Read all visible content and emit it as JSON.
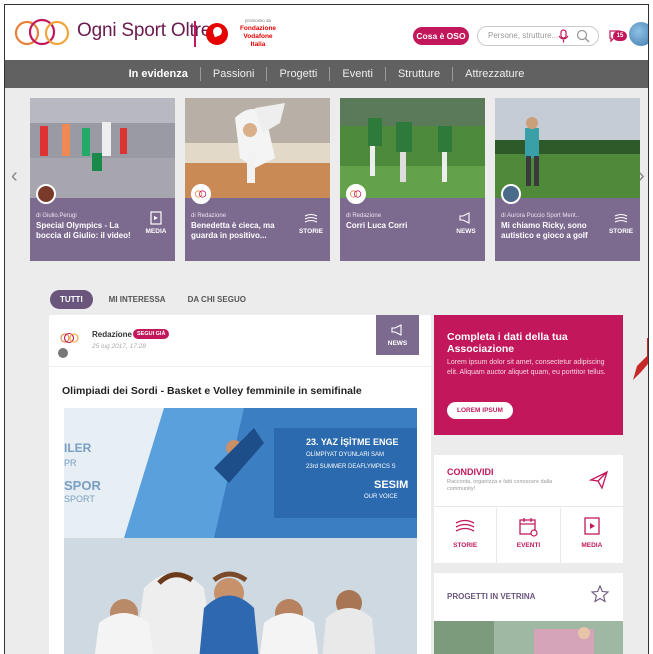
{
  "brand": {
    "name": "Ogni Sport Oltre",
    "partner_small": "promosso da",
    "partner_line1": "Fondazione",
    "partner_line2": "Vodafone",
    "partner_line3": "Italia"
  },
  "header": {
    "cosa_button": "Cosa è OSO",
    "search_placeholder": "Persone, strutture...",
    "notification_count": "15"
  },
  "nav": {
    "items": [
      "In evidenza",
      "Passioni",
      "Progetti",
      "Eventi",
      "Strutture",
      "Attrezzature"
    ],
    "active": "In evidenza"
  },
  "carousel": {
    "cards": [
      {
        "author": "di Giulio.Perugi",
        "title": "Special Olympics - La boccia di Giulio: il video!",
        "category": "MEDIA"
      },
      {
        "author": "di Redazione",
        "title": "Benedetta è cieca, ma guarda in positivo...",
        "category": "STORIE"
      },
      {
        "author": "di Redazione",
        "title": "Corri Luca Corri",
        "category": "NEWS"
      },
      {
        "author": "di Aurora Puccio Sport Ment..",
        "title": "Mi chiamo Ricky, sono autistico e gioco a golf",
        "category": "STORIE"
      }
    ]
  },
  "filters": {
    "tabs": [
      "TUTTI",
      "MI INTERESSA",
      "DA CHI SEGUO"
    ],
    "active": "TUTTI"
  },
  "post": {
    "author": "Redazione",
    "follow_label": "SEGUI GIÀ",
    "date": "25 lug 2017, 17:28",
    "category": "NEWS",
    "title": "Olimpiadi dei Sordi - Basket e Volley femminile in semifinale",
    "image_banner_line1": "23. YAZ İŞİTME ENGE",
    "image_banner_line2": "OLİMPİYAT OYUNLARI SAM",
    "image_banner_line3": "23rd SUMMER DEAFLYMPICS S",
    "image_banner_side1": "ILER",
    "image_banner_side2": "PR",
    "image_banner_side3": "SPOR",
    "image_banner_side4": "SPORT",
    "image_banner_right": "SESIM",
    "image_banner_right2": "OUR VOICE"
  },
  "promo": {
    "title": "Completa i dati della tua Associazione",
    "text": "Lorem ipsum dolor sit amet, consectetur adipiscing elit. Aliquam auctor aliquet quam, eu porttitor tellus.",
    "button": "LOREM IPSUM"
  },
  "condividi": {
    "title": "CONDIVIDI",
    "subtitle": "Racconta, organizza e fatti conoscere dalla community!",
    "actions": [
      "STORIE",
      "EVENTI",
      "MEDIA"
    ]
  },
  "vetrina": {
    "title": "PROGETTI IN VETRINA"
  },
  "colors": {
    "magenta": "#c2185b",
    "purple": "#7d6a8f",
    "nav_gray": "#616161",
    "page_bg": "#ececec"
  }
}
